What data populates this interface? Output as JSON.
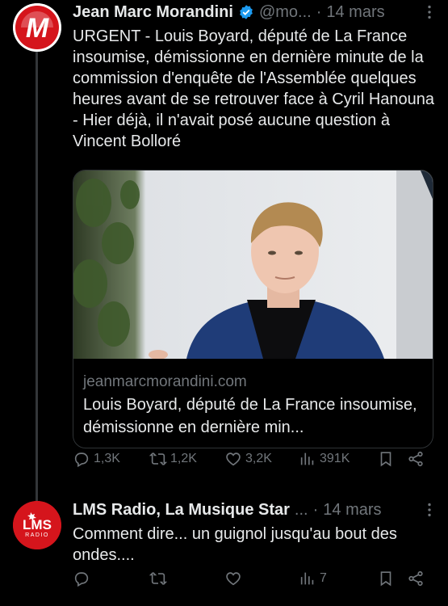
{
  "posts": [
    {
      "author": "Jean Marc Morandini",
      "handle": "@mo...",
      "separator": "·",
      "time": "14 mars",
      "avatar_letter": "M",
      "text": "URGENT - Louis Boyard, député de La France insoumise, démissionne en dernière minute de la commission d'enquête de l'Assemblée quelques heures avant de se retrouver face à Cyril Hanouna - Hier déjà, il n'avait posé aucune question à Vincent Bolloré",
      "card": {
        "domain": "jeanmarcmorandini.com",
        "title": "Louis Boyard, député de La France insoumise, démissionne en dernière min..."
      },
      "actions": {
        "replies": "1,3K",
        "reposts": "1,2K",
        "likes": "3,2K",
        "views": "391K"
      }
    },
    {
      "author": "LMS Radio, La Musique Star",
      "handle": "...",
      "separator": "·",
      "time": "14 mars",
      "avatar_text": "LMS",
      "avatar_subtext": "RADIO",
      "text": "Comment dire... un guignol jusqu'au bout des ondes....",
      "actions": {
        "replies": "",
        "reposts": "",
        "likes": "",
        "views": "7"
      }
    }
  ],
  "colors": {
    "background": "#000000",
    "text": "#e7e9ea",
    "muted": "#71767b",
    "verified": "#1d9bf0",
    "brand_red": "#d5151c"
  },
  "icons": [
    "reply-icon",
    "repost-icon",
    "like-icon",
    "views-icon",
    "bookmark-icon",
    "share-icon",
    "more-icon",
    "verified-icon"
  ]
}
